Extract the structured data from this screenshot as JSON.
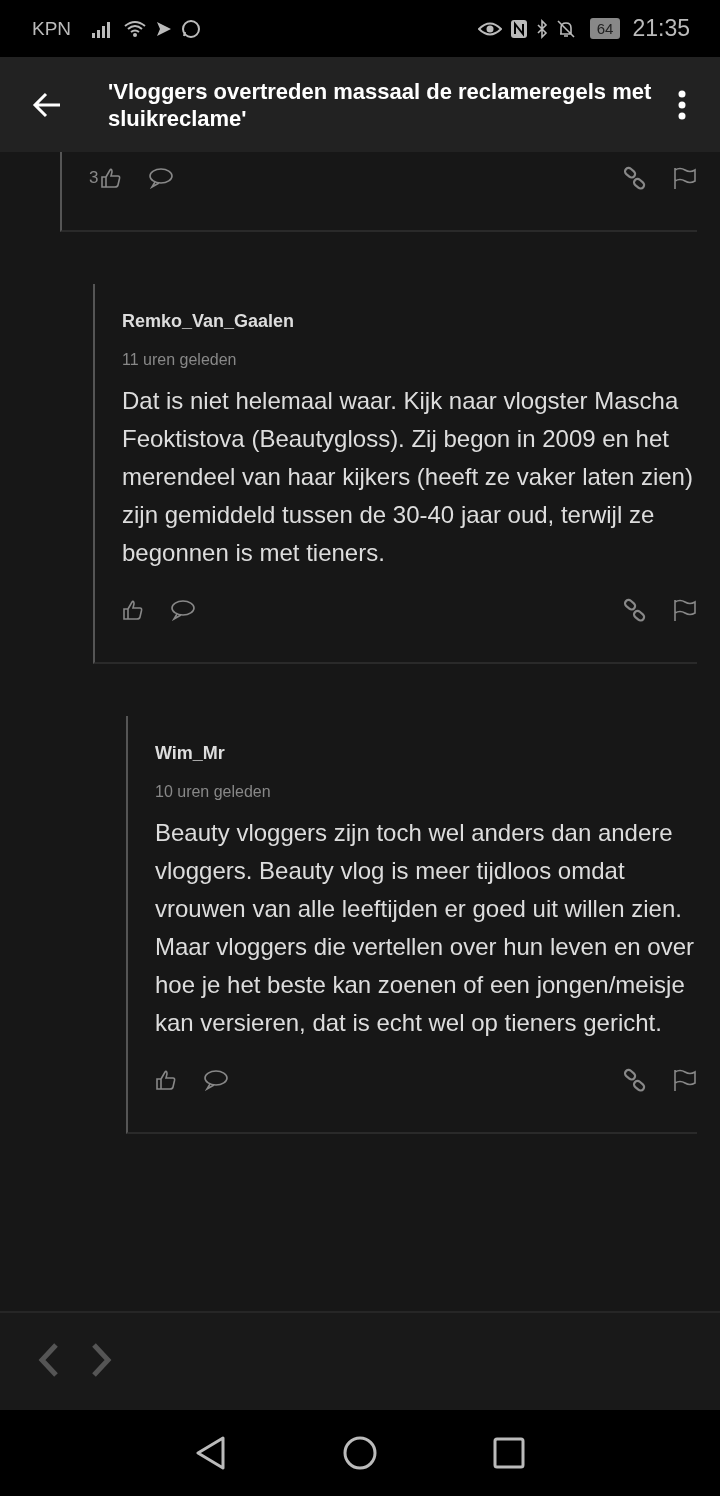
{
  "status_bar": {
    "carrier": "KPN",
    "battery": "64",
    "time": "21:35"
  },
  "app_bar": {
    "title": "'Vloggers overtreden massaal de reclameregels met sluikreclame'"
  },
  "comments": [
    {
      "likes": "3",
      "children": [
        {
          "author": "Remko_Van_Gaalen",
          "time": "11 uren geleden",
          "body": "Dat is niet helemaal waar. Kijk naar vlogster Mascha Feoktistova (Beautygloss). Zij begon in 2009 en het merendeel van haar kijkers (heeft ze vaker laten zien) zijn gemiddeld tussen de 30-40 jaar oud, terwijl ze begonnen is met tieners.",
          "children": [
            {
              "author": "Wim_Mr",
              "time": "10 uren geleden",
              "body": "Beauty vloggers zijn toch wel anders dan andere vloggers. Beauty vlog is meer tijdloos omdat vrouwen van alle leeftijden er goed uit willen zien. Maar vloggers die vertellen over hun leven en over hoe je het beste kan zoenen of een jongen/meisje kan versieren, dat is echt wel op tieners gericht."
            }
          ]
        }
      ]
    }
  ]
}
